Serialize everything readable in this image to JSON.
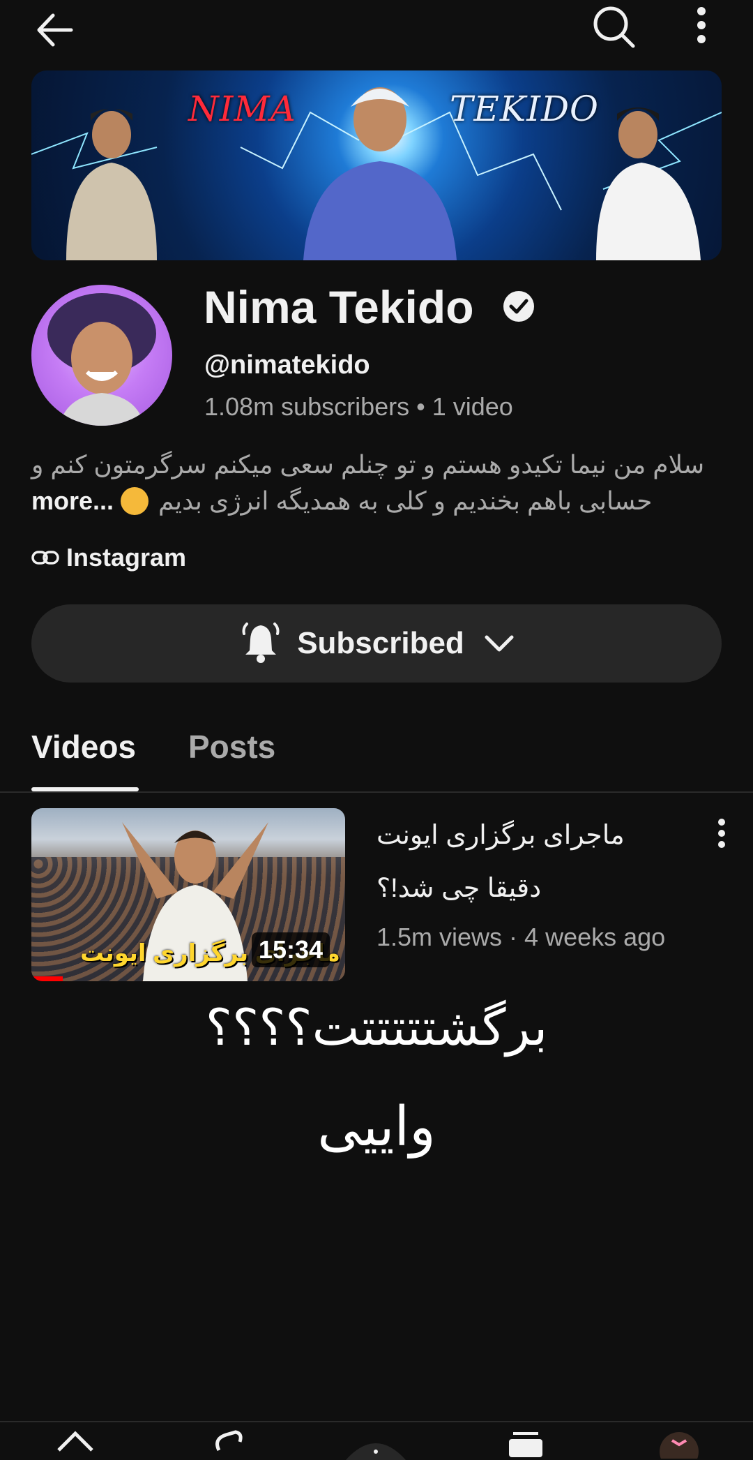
{
  "header": {
    "back_icon": "arrow-left-icon",
    "search_icon": "search-icon",
    "more_icon": "more-vert-icon"
  },
  "banner": {
    "text_left": "NIMA",
    "text_right": "TEKIDO"
  },
  "channel": {
    "name": "Nima Tekido",
    "verified_icon": "verified-check-icon",
    "handle": "@nimatekido",
    "stats": "1.08m subscribers • 1 video",
    "description_line1": "سلام من نیما تکیدو هستم و تو چنلم سعی میکنم سرگرمتون کنم و",
    "description_line2": "حسابی باهم بخندیم و کلی به همدیگه انرژی بدیم",
    "more_label": "more...",
    "link_label": "Instagram"
  },
  "subscribe": {
    "label": "Subscribed",
    "bell_icon": "bell-icon",
    "chevron_icon": "chevron-down-icon"
  },
  "tabs": [
    {
      "label": "Videos",
      "active": true
    },
    {
      "label": "Posts",
      "active": false
    }
  ],
  "video": {
    "title_line1": "ماجرای برگزاری ایونت",
    "title_line2": "دقیقا چی شد!؟",
    "meta": "1.5m views · 4 weeks ago",
    "duration": "15:34",
    "thumbnail_caption": "ماجرای برگزاری ایونت",
    "watch_progress": 0.1
  },
  "overlay": {
    "line1": "برگشتتتتتت؟؟؟؟",
    "line2": "واییی"
  },
  "colors": {
    "background": "#0f0f0f",
    "text_primary": "#f1f1f1",
    "text_secondary": "#aaaaaa",
    "button_bg": "#272727",
    "progress_red": "#ff0000"
  }
}
